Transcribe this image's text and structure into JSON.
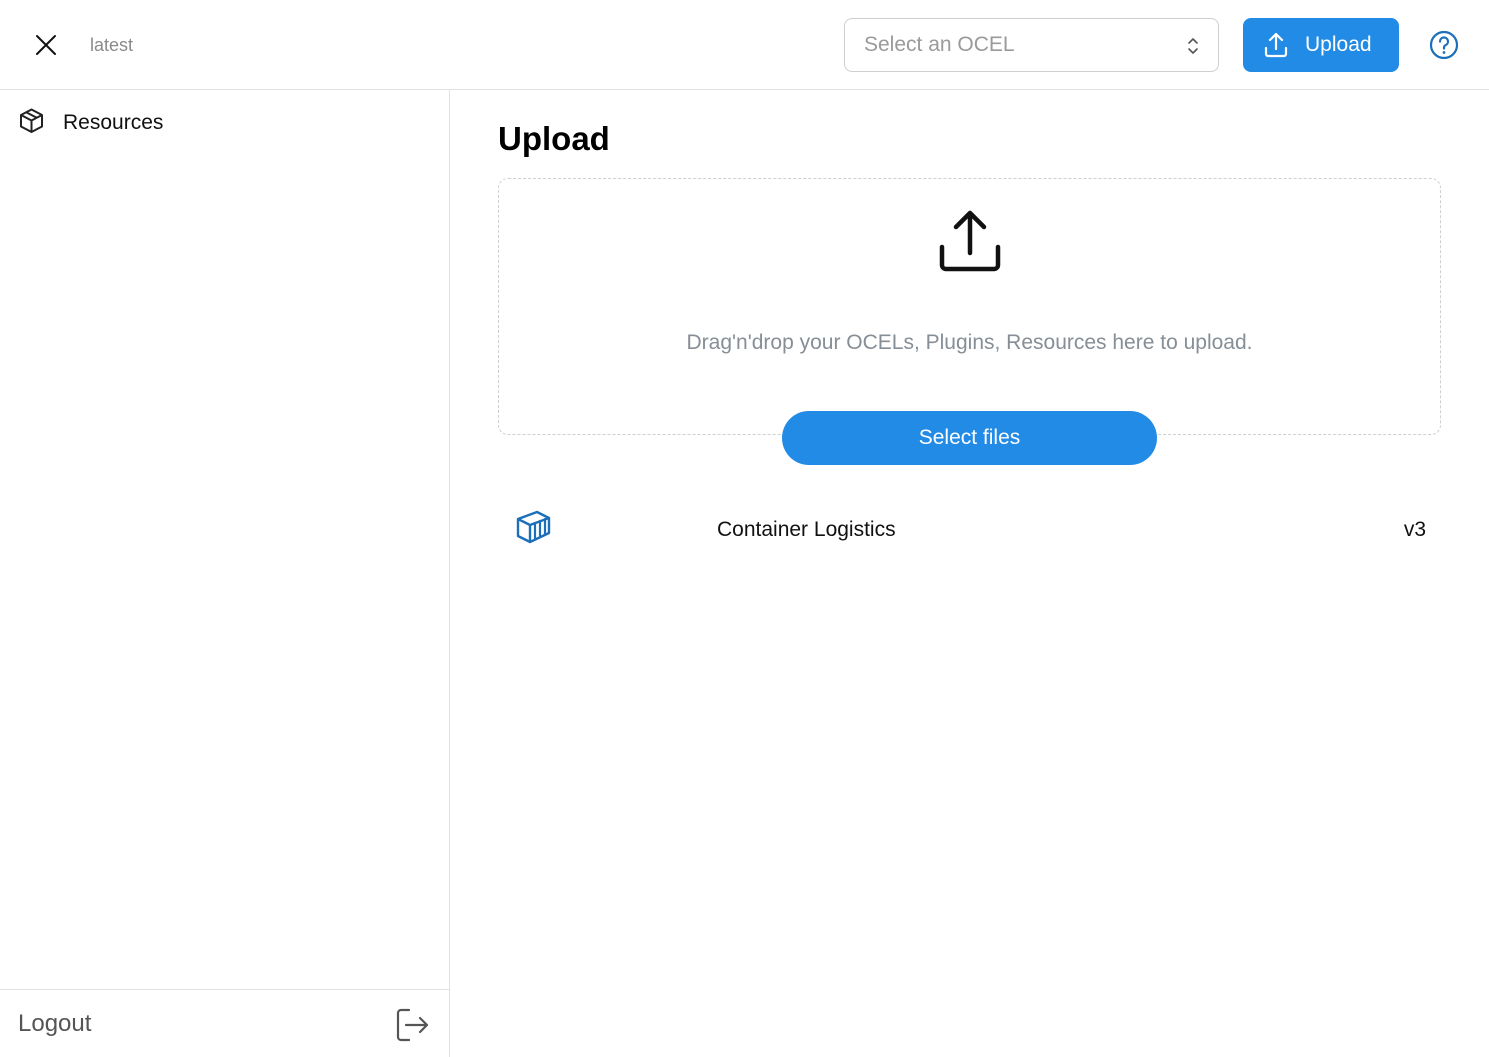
{
  "header": {
    "version_label": "latest",
    "ocel_select": {
      "placeholder": "Select an OCEL",
      "icon": "chevron-up-down-icon"
    },
    "upload_button": {
      "label": "Upload",
      "icon": "upload-icon"
    },
    "help_icon": "help-circle-icon",
    "close_icon": "close-icon"
  },
  "sidebar": {
    "items": [
      {
        "label": "Resources",
        "icon": "cube-icon"
      }
    ],
    "footer": {
      "logout_label": "Logout",
      "logout_icon": "logout-icon"
    }
  },
  "main": {
    "title": "Upload",
    "dropzone": {
      "hint": "Drag'n'drop your OCELs, Plugins, Resources here to upload.",
      "icon": "upload-icon"
    },
    "select_files_label": "Select files",
    "resources": [
      {
        "name": "Container Logistics",
        "version": "v3",
        "icon": "container-icon"
      }
    ]
  },
  "colors": {
    "accent": "#228be6",
    "icon_blue": "#1c6fb8",
    "muted_text": "#868e96",
    "border": "#e2e2e2"
  }
}
